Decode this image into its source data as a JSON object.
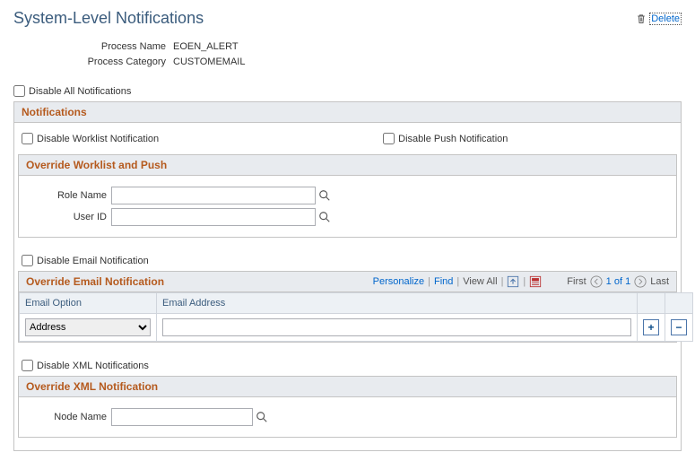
{
  "page_title": "System-Level Notifications",
  "delete_label": "Delete",
  "fields": {
    "process_name_label": "Process Name",
    "process_name_value": "EOEN_ALERT",
    "process_category_label": "Process Category",
    "process_category_value": "CUSTOMEMAIL"
  },
  "disable_all_label": "Disable All Notifications",
  "notifications": {
    "header": "Notifications",
    "disable_worklist": "Disable Worklist Notification",
    "disable_push": "Disable Push Notification",
    "override_wl_push_header": "Override Worklist and Push",
    "role_name_label": "Role Name",
    "user_id_label": "User ID",
    "role_name_value": "",
    "user_id_value": ""
  },
  "email": {
    "disable_label": "Disable Email Notification",
    "override_header": "Override Email Notification",
    "personalize": "Personalize",
    "find": "Find",
    "view_all": "View All",
    "first": "First",
    "counter": "1 of 1",
    "last": "Last",
    "col_option": "Email Option",
    "col_address": "Email Address",
    "option_selected": "Address",
    "address_value": ""
  },
  "xml": {
    "disable_label": "Disable XML Notifications",
    "override_header": "Override XML Notification",
    "node_name_label": "Node Name",
    "node_name_value": ""
  }
}
